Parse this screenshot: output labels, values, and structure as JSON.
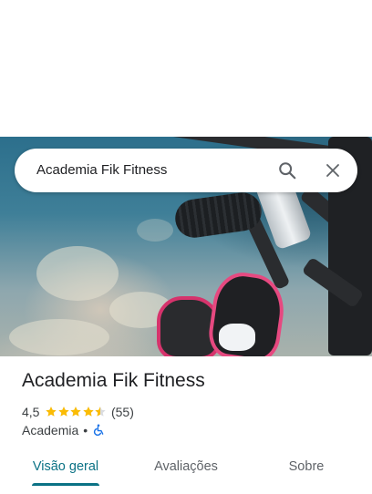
{
  "search": {
    "query": "Academia Fik Fitness"
  },
  "icons": {
    "search": "search-icon",
    "close": "close-icon",
    "accessible": "wheelchair-icon"
  },
  "place": {
    "name": "Academia Fik Fitness",
    "rating": "4,5",
    "rating_value": 4.5,
    "rating_max": 5,
    "review_count": "(55)",
    "category": "Academia",
    "separator": "•"
  },
  "tabs": [
    {
      "label": "Visão geral",
      "active": true
    },
    {
      "label": "Avaliações",
      "active": false
    },
    {
      "label": "Sobre",
      "active": false
    }
  ],
  "colors": {
    "accent": "#0b7285",
    "star": "#fbbc04",
    "accessible": "#1a73e8"
  }
}
